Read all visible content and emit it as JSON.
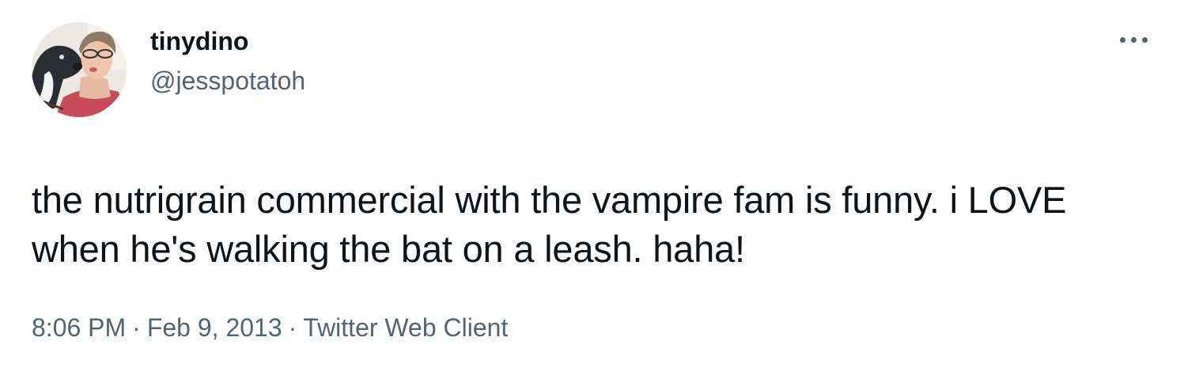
{
  "author": {
    "display_name": "tinydino",
    "handle": "@jesspotatoh"
  },
  "more_menu": {
    "icon": "more-horizontal-icon"
  },
  "tweet": {
    "text": "the nutrigrain commercial with the vampire fam is funny. i LOVE when he's walking the bat on a leash. haha!"
  },
  "meta": {
    "time": "8:06 PM",
    "separator": "·",
    "date": "Feb 9, 2013",
    "client": "Twitter Web Client"
  },
  "colors": {
    "text_primary": "#0f1419",
    "text_secondary": "#536471"
  }
}
